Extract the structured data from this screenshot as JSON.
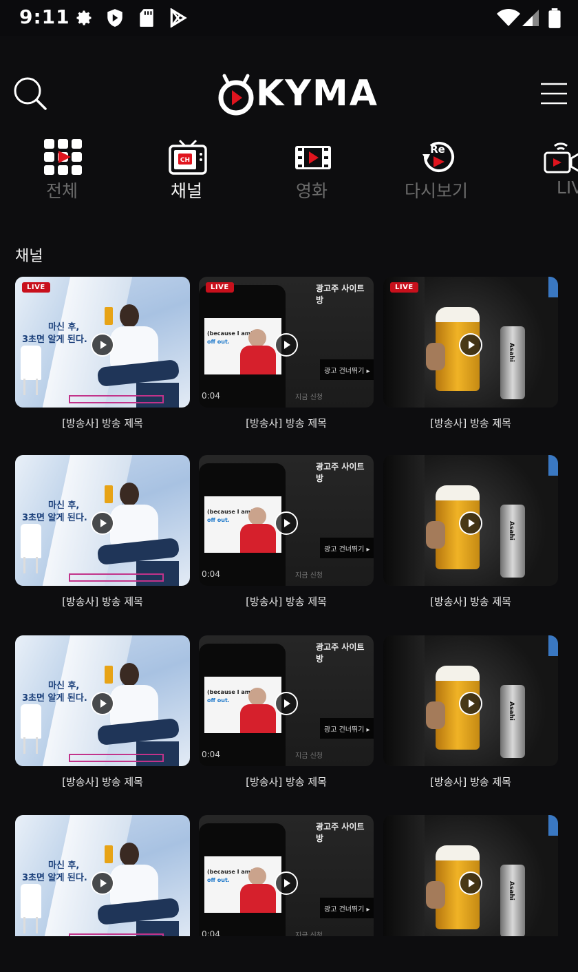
{
  "status_bar": {
    "time": "9:11",
    "icons": [
      "gear-icon",
      "shield-icon",
      "sd-card-icon",
      "play-store-icon",
      "wifi-icon",
      "signal-icon",
      "battery-icon"
    ]
  },
  "header": {
    "logo_text": "KYMA",
    "search_icon": "search-icon",
    "menu_icon": "hamburger-menu-icon"
  },
  "categories": [
    {
      "label": "전체",
      "icon": "grid-play-icon",
      "active": false
    },
    {
      "label": "채널",
      "icon": "tv-channel-icon",
      "active": true
    },
    {
      "label": "영화",
      "icon": "film-icon",
      "active": false
    },
    {
      "label": "다시보기",
      "icon": "replay-icon",
      "active": false
    },
    {
      "label": "LIVE",
      "icon": "live-camera-icon",
      "active": false
    }
  ],
  "section": {
    "title": "채널"
  },
  "cards": [
    {
      "title": "[방송사] 방송 제목",
      "live": true,
      "badge": "LIVE",
      "thumb": "beer-ad-man"
    },
    {
      "title": "[방송사] 방송 제목",
      "live": true,
      "badge": "LIVE",
      "thumb": "phone-ad"
    },
    {
      "title": "[방송사] 방송 제목",
      "live": true,
      "badge": "LIVE",
      "thumb": "asahi-beer"
    },
    {
      "title": "[방송사] 방송 제목",
      "live": false,
      "thumb": "beer-ad-man"
    },
    {
      "title": "[방송사] 방송 제목",
      "live": false,
      "thumb": "phone-ad"
    },
    {
      "title": "[방송사] 방송 제목",
      "live": false,
      "thumb": "asahi-beer"
    },
    {
      "title": "[방송사] 방송 제목",
      "live": false,
      "thumb": "beer-ad-man"
    },
    {
      "title": "[방송사] 방송 제목",
      "live": false,
      "thumb": "phone-ad"
    },
    {
      "title": "[방송사] 방송 제목",
      "live": false,
      "thumb": "asahi-beer"
    },
    {
      "title": "",
      "live": false,
      "thumb": "beer-ad-man"
    },
    {
      "title": "",
      "live": false,
      "thumb": "phone-ad"
    },
    {
      "title": "",
      "live": false,
      "thumb": "asahi-beer"
    }
  ],
  "thumb_text": {
    "beer_ad_line1": "마신 후,",
    "beer_ad_line2": "3초면 알게 된다.",
    "phone_ad_top": "광고주 사이트 방",
    "phone_ad_caption1": "(because I am)",
    "phone_ad_caption2": "off out.",
    "phone_ad_skip": "광고 건너뛰기",
    "phone_ad_sub": "지금 신청",
    "phone_ad_time": "0:04",
    "asahi_label": "Asahi"
  },
  "colors": {
    "background": "#0d0d0f",
    "accent_red": "#e0141e",
    "live_badge": "#c8101c",
    "inactive_label": "#6b6b6b"
  }
}
